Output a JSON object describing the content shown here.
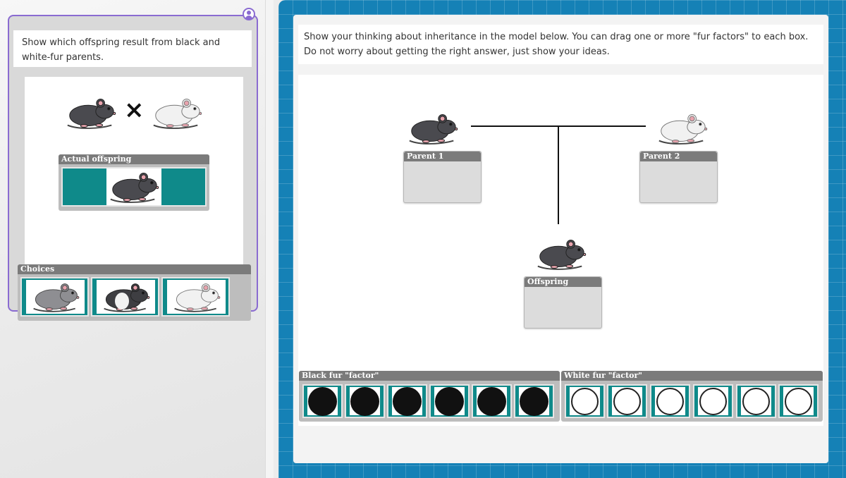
{
  "left_card": {
    "prompt": "Show which offspring result from black and white-fur parents.",
    "cross_symbol": "×",
    "actual_offspring_title": "Actual offspring",
    "choices_title": "Choices"
  },
  "right_panel": {
    "prompt": "Show your thinking about inheritance in the model below. You can drag one or more \"fur factors\" to each box. Do not worry about getting the right answer, just show your ideas.",
    "parent1_label": "Parent 1",
    "parent2_label": "Parent 2",
    "offspring_label": "Offspring",
    "black_bank_title": "Black fur \"factor\"",
    "white_bank_title": "White fur \"factor\""
  },
  "colors": {
    "accent_purple": "#8a6bd1",
    "teal": "#0f8a8a",
    "frame_blue": "#1581b6",
    "box_header": "#7b7b7b"
  },
  "icons": {
    "black_mouse": "black-mouse-icon",
    "white_mouse": "white-mouse-icon",
    "gray_mouse": "gray-mouse-icon",
    "spotted_mouse": "spotted-mouse-icon",
    "user": "user-avatar-icon"
  }
}
